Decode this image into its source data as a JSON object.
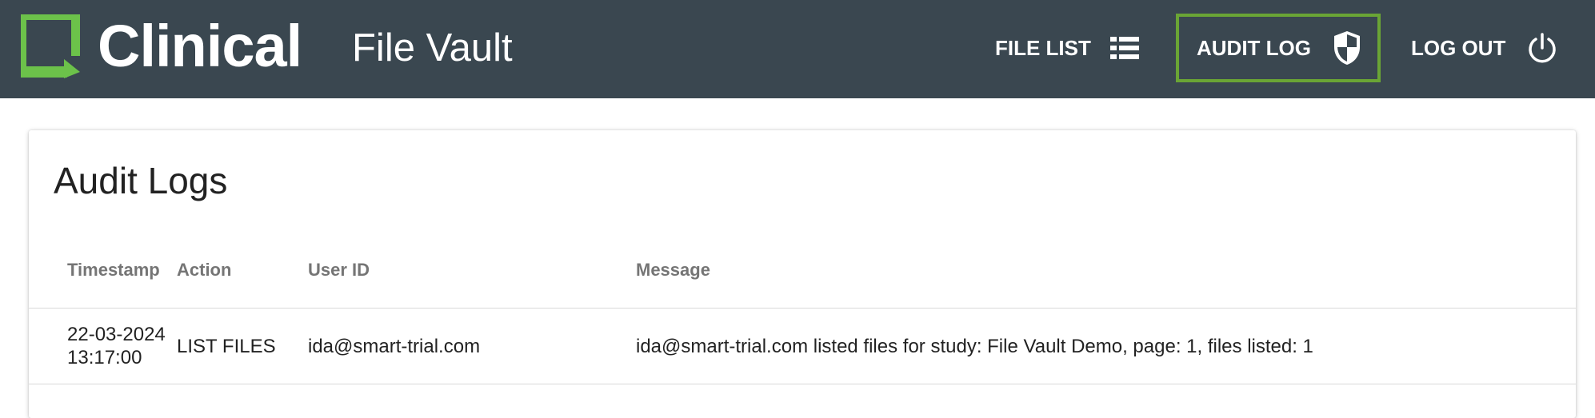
{
  "header": {
    "logo_text": "Clinical",
    "app_title": "File Vault",
    "brand_color": "#6cc24a",
    "bar_color": "#3a4750",
    "active_border_color": "#6aa535",
    "nav": [
      {
        "label": "FILE LIST",
        "icon": "list-icon",
        "active": false
      },
      {
        "label": "AUDIT LOG",
        "icon": "shield-icon",
        "active": true
      },
      {
        "label": "LOG OUT",
        "icon": "power-icon",
        "active": false
      }
    ]
  },
  "main": {
    "title": "Audit Logs",
    "columns": [
      "Timestamp",
      "Action",
      "User ID",
      "Message"
    ],
    "rows": [
      {
        "timestamp_date": "22-03-2024",
        "timestamp_time": "13:17:00",
        "action": "LIST FILES",
        "user_id": "ida@smart-trial.com",
        "message": "ida@smart-trial.com listed files for study: File Vault Demo, page: 1, files listed: 1"
      }
    ]
  }
}
